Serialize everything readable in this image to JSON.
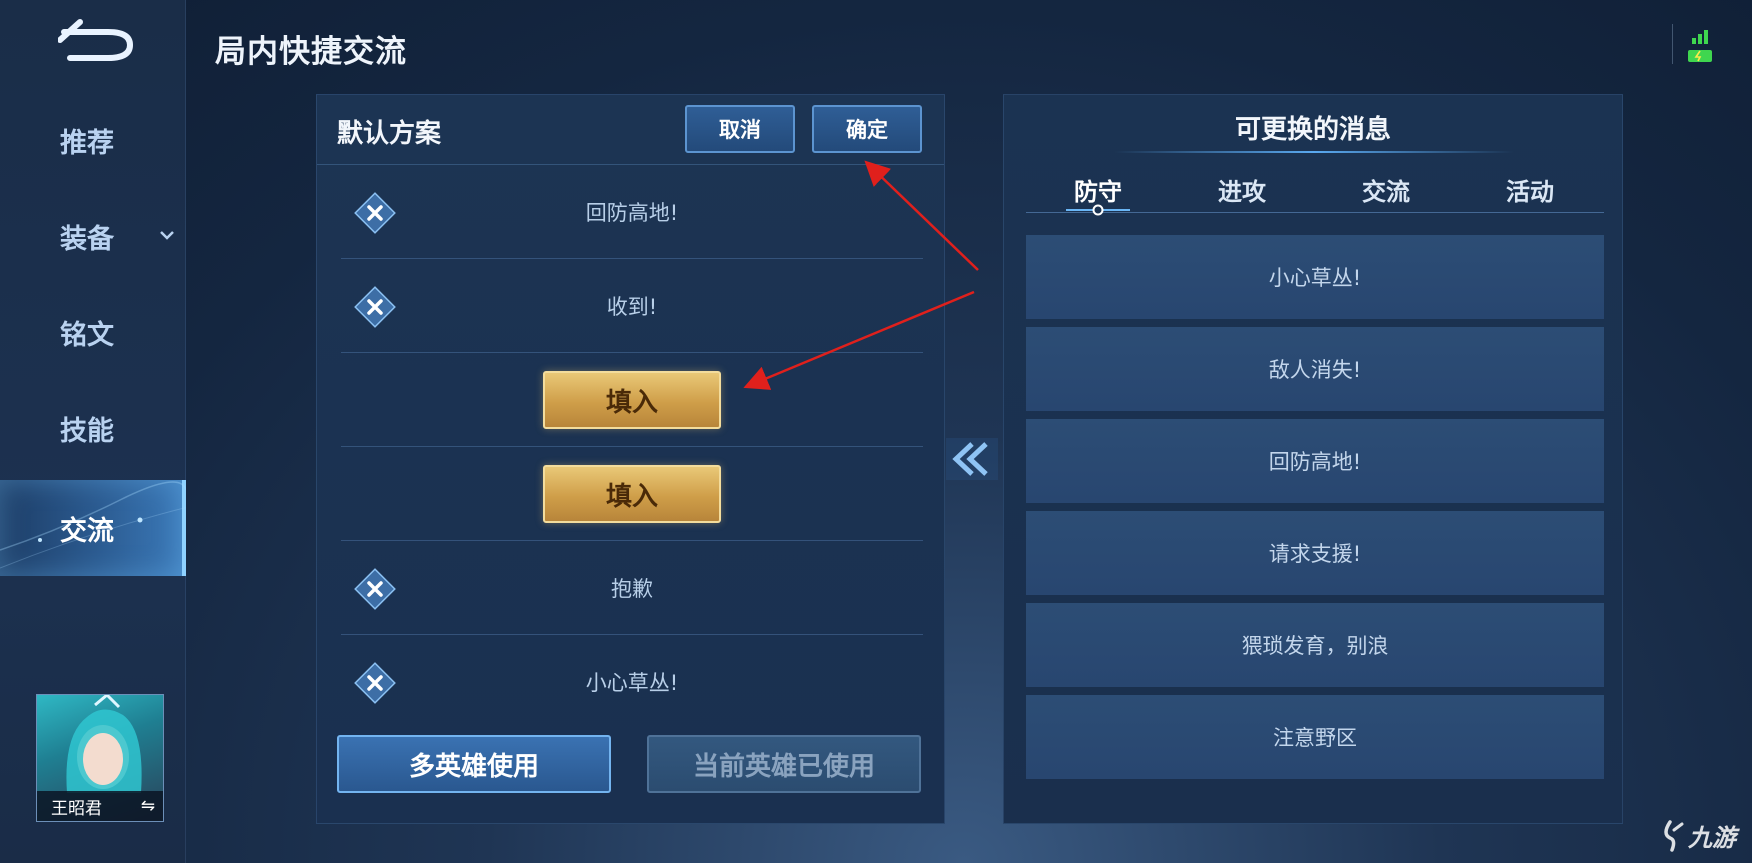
{
  "header": {
    "title": "局内快捷交流"
  },
  "sidebar": {
    "items": [
      {
        "label": "推荐"
      },
      {
        "label": "装备"
      },
      {
        "label": "铭文"
      },
      {
        "label": "技能"
      },
      {
        "label": "交流"
      }
    ],
    "active_index": 4,
    "hero": {
      "name": "王昭君",
      "switch_glyph": "⇋"
    }
  },
  "scheme": {
    "title": "默认方案",
    "cancel_label": "取消",
    "confirm_label": "确定",
    "rows": [
      {
        "type": "message",
        "text": "回防高地!"
      },
      {
        "type": "message",
        "text": "收到!"
      },
      {
        "type": "fill",
        "text": "填入"
      },
      {
        "type": "fill",
        "text": "填入"
      },
      {
        "type": "message",
        "text": "抱歉"
      },
      {
        "type": "message",
        "text": "小心草丛!"
      }
    ],
    "multi_hero_label": "多英雄使用",
    "current_hero_label": "当前英雄已使用"
  },
  "replace": {
    "title": "可更换的消息",
    "tabs": [
      "防守",
      "进攻",
      "交流",
      "活动"
    ],
    "active_tab": 0,
    "messages": [
      "小心草丛!",
      "敌人消失!",
      "回防高地!",
      "请求支援!",
      "猥琐发育，别浪",
      "注意野区"
    ]
  },
  "watermark": {
    "text": "九游"
  },
  "colors": {
    "accent": "#5c94d0",
    "gold": "#d9ab57",
    "annotation": "#e0201c"
  }
}
